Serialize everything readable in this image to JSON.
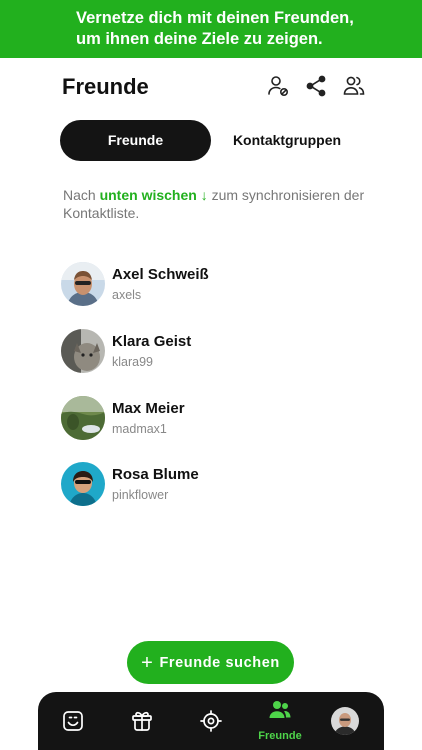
{
  "banner": {
    "line1": "Vernetze dich mit deinen Freunden,",
    "line2": "um ihnen deine Ziele zu zeigen."
  },
  "header": {
    "title": "Freunde",
    "icons": [
      "person-remove-icon",
      "share-icon",
      "people-icon"
    ]
  },
  "tabs": {
    "active": "Freunde",
    "inactive": "Kontaktgruppen"
  },
  "hint": {
    "prefix": "Nach ",
    "highlight": "unten wischen ↓",
    "suffix": " zum synchronisieren der Kontaktliste."
  },
  "friends": [
    {
      "name": "Axel Schweiß",
      "username": "axels"
    },
    {
      "name": "Klara Geist",
      "username": "klara99"
    },
    {
      "name": "Max Meier",
      "username": "madmax1"
    },
    {
      "name": "Rosa Blume",
      "username": "pinkflower"
    }
  ],
  "cta": {
    "label": "Freunde suchen"
  },
  "nav": {
    "items": [
      "journal-icon",
      "basket-icon",
      "target-icon",
      "friends-icon",
      "profile-avatar"
    ],
    "active_label": "Freunde"
  },
  "colors": {
    "accent": "#22b01e",
    "dark": "#141414",
    "nav_active": "#4ed44a"
  }
}
